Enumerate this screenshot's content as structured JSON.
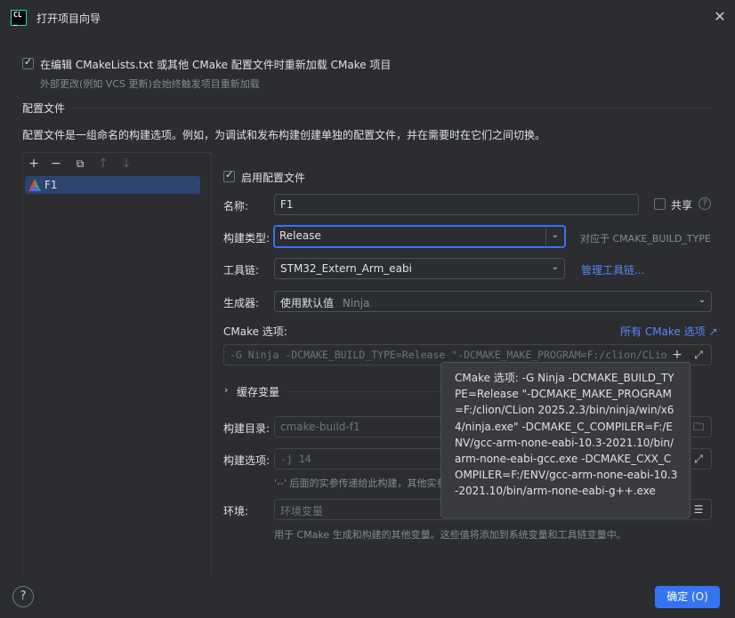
{
  "window": {
    "title": "打开项目向导"
  },
  "reload": {
    "checkbox_label": "在编辑 CMakeLists.txt 或其他 CMake 配置文件时重新加载 CMake 项目",
    "hint": "外部更改(例如 VCS 更新)会始终触发项目重新加载"
  },
  "profiles_section": {
    "heading": "配置文件",
    "description": "配置文件是一组命名的构建选项。例如，为调试和发布构建创建单独的配置文件，并在需要时在它们之间切换。",
    "items": [
      {
        "label": "F1"
      }
    ]
  },
  "form": {
    "enable_label": "启用配置文件",
    "name_label": "名称:",
    "name_value": "F1",
    "share_label": "共享",
    "build_type_label": "构建类型:",
    "build_type_value": "Release",
    "build_type_hint": "对应于 CMAKE_BUILD_TYPE",
    "toolchain_label": "工具链:",
    "toolchain_value": "STM32_Extern_Arm_eabi",
    "manage_toolchains": "管理工具链...",
    "generator_label": "生成器:",
    "generator_value": "使用默认值",
    "generator_hint": "Ninja",
    "cmake_options_label": "CMake 选项:",
    "all_cmake_options": "所有 CMake 选项",
    "cmake_options_value": "-G Ninja -DCMAKE_BUILD_TYPE=Release \"-DCMAKE_MAKE_PROGRAM=F:/clion/CLio",
    "cache_vars_label": "缓存变量",
    "build_dir_label": "构建目录:",
    "build_dir_value": "cmake-build-f1",
    "build_options_label": "构建选项:",
    "build_options_value": "-j 14",
    "build_options_hint": "'--' 后面的实参传递给此构建，其他实参",
    "env_label": "环境:",
    "env_placeholder": "环境变量",
    "env_hint": "用于 CMake 生成和构建的其他变量。这些值将添加到系统变量和工具链变量中。"
  },
  "tooltip": {
    "text": "CMake 选项: -G Ninja -DCMAKE_BUILD_TYPE=Release \"-DCMAKE_MAKE_PROGRAM=F:/clion/CLion 2025.2.3/bin/ninja/win/x64/ninja.exe\" -DCMAKE_C_COMPILER=F:/ENV/gcc-arm-none-eabi-10.3-2021.10/bin/arm-none-eabi-gcc.exe -DCMAKE_CXX_COMPILER=F:/ENV/gcc-arm-none-eabi-10.3-2021.10/bin/arm-none-eabi-g++.exe"
  },
  "footer": {
    "ok_label": "确定 (O)",
    "help_symbol": "?"
  },
  "colors": {
    "accent": "#3574f0",
    "background": "#2b2d30",
    "link": "#548af7"
  }
}
